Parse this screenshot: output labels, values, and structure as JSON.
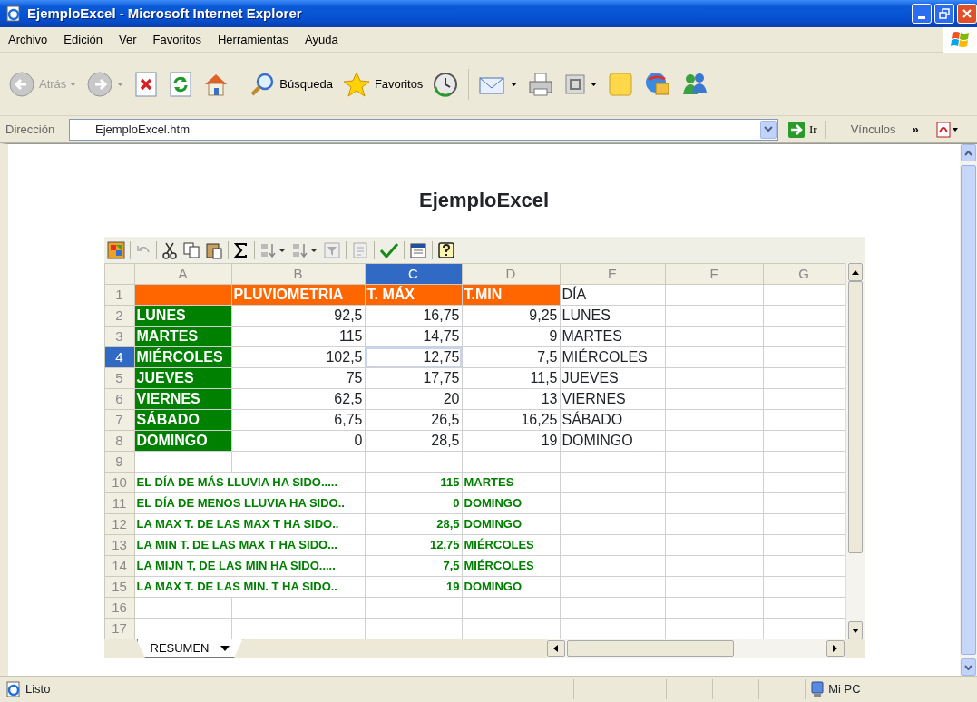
{
  "window": {
    "title": "EjemploExcel - Microsoft Internet Explorer"
  },
  "menu": [
    "Archivo",
    "Edición",
    "Ver",
    "Favoritos",
    "Herramientas",
    "Ayuda"
  ],
  "toolbar": {
    "back": {
      "label": "Atrás",
      "disabled": true
    },
    "forward": {
      "disabled": true
    },
    "search": {
      "label": "Búsqueda"
    },
    "favorites": {
      "label": "Favoritos"
    }
  },
  "address_bar": {
    "label": "Dirección",
    "value": "EjemploExcel.htm",
    "go_label": "Ir",
    "links_label": "Vínculos",
    "links_more": "»"
  },
  "page": {
    "heading": "EjemploExcel"
  },
  "spreadsheet": {
    "columns": [
      {
        "label": "A",
        "selected": false
      },
      {
        "label": "B",
        "selected": false
      },
      {
        "label": "C",
        "selected": true
      },
      {
        "label": "D",
        "selected": false
      },
      {
        "label": "E",
        "selected": false
      },
      {
        "label": "F",
        "selected": false
      },
      {
        "label": "G",
        "selected": false
      }
    ],
    "rows": [
      {
        "number": "1",
        "selected": false,
        "kind": "header",
        "cells": [
          "PLUVIOMETRIA",
          "T. MÁX",
          "T.MIN",
          "DÍA"
        ]
      },
      {
        "number": "2",
        "selected": false,
        "kind": "data",
        "cells": [
          "LUNES",
          "92,5",
          "16,75",
          "9,25",
          "LUNES"
        ]
      },
      {
        "number": "3",
        "selected": false,
        "kind": "data",
        "cells": [
          "MARTES",
          "115",
          "14,75",
          "9",
          "MARTES"
        ]
      },
      {
        "number": "4",
        "selected": true,
        "kind": "data",
        "cells": [
          "MIÉRCOLES",
          "102,5",
          "12,75",
          "7,5",
          "MIÉRCOLES"
        ]
      },
      {
        "number": "5",
        "selected": false,
        "kind": "data",
        "cells": [
          "JUEVES",
          "75",
          "17,75",
          "11,5",
          "JUEVES"
        ]
      },
      {
        "number": "6",
        "selected": false,
        "kind": "data",
        "cells": [
          "VIERNES",
          "62,5",
          "20",
          "13",
          "VIERNES"
        ]
      },
      {
        "number": "7",
        "selected": false,
        "kind": "data",
        "cells": [
          "SÁBADO",
          "6,75",
          "26,5",
          "16,25",
          "SÁBADO"
        ]
      },
      {
        "number": "8",
        "selected": false,
        "kind": "data",
        "cells": [
          "DOMINGO",
          "0",
          "28,5",
          "19",
          "DOMINGO"
        ]
      },
      {
        "number": "9",
        "selected": false,
        "kind": "empty"
      },
      {
        "number": "10",
        "selected": false,
        "kind": "summary",
        "cells": [
          "EL DÍA DE MÁS LLUVIA HA SIDO.....",
          "115",
          "MARTES"
        ]
      },
      {
        "number": "11",
        "selected": false,
        "kind": "summary",
        "cells": [
          "EL DÍA DE MENOS LLUVIA HA SIDO..",
          "0",
          "DOMINGO"
        ]
      },
      {
        "number": "12",
        "selected": false,
        "kind": "summary",
        "cells": [
          "LA MAX T. DE LAS MAX T HA SIDO..",
          "28,5",
          "DOMINGO"
        ]
      },
      {
        "number": "13",
        "selected": false,
        "kind": "summary",
        "cells": [
          "LA MIN T. DE LAS MAX T HA SIDO...",
          "12,75",
          "MIÉRCOLES"
        ]
      },
      {
        "number": "14",
        "selected": false,
        "kind": "summary",
        "cells": [
          "LA MIJN T, DE LAS MIN HA SIDO.....",
          "7,5",
          "MIÉRCOLES"
        ]
      },
      {
        "number": "15",
        "selected": false,
        "kind": "summary",
        "cells": [
          "LA MAX T. DE LAS MIN. T HA SIDO..",
          "19",
          "DOMINGO"
        ]
      },
      {
        "number": "16",
        "selected": false,
        "kind": "empty"
      },
      {
        "number": "17",
        "selected": false,
        "kind": "empty"
      }
    ],
    "sheet_tab": {
      "label": "RESUMEN",
      "selected": true
    }
  },
  "status_bar": {
    "text": "Listo",
    "zone": "Mi PC"
  }
}
